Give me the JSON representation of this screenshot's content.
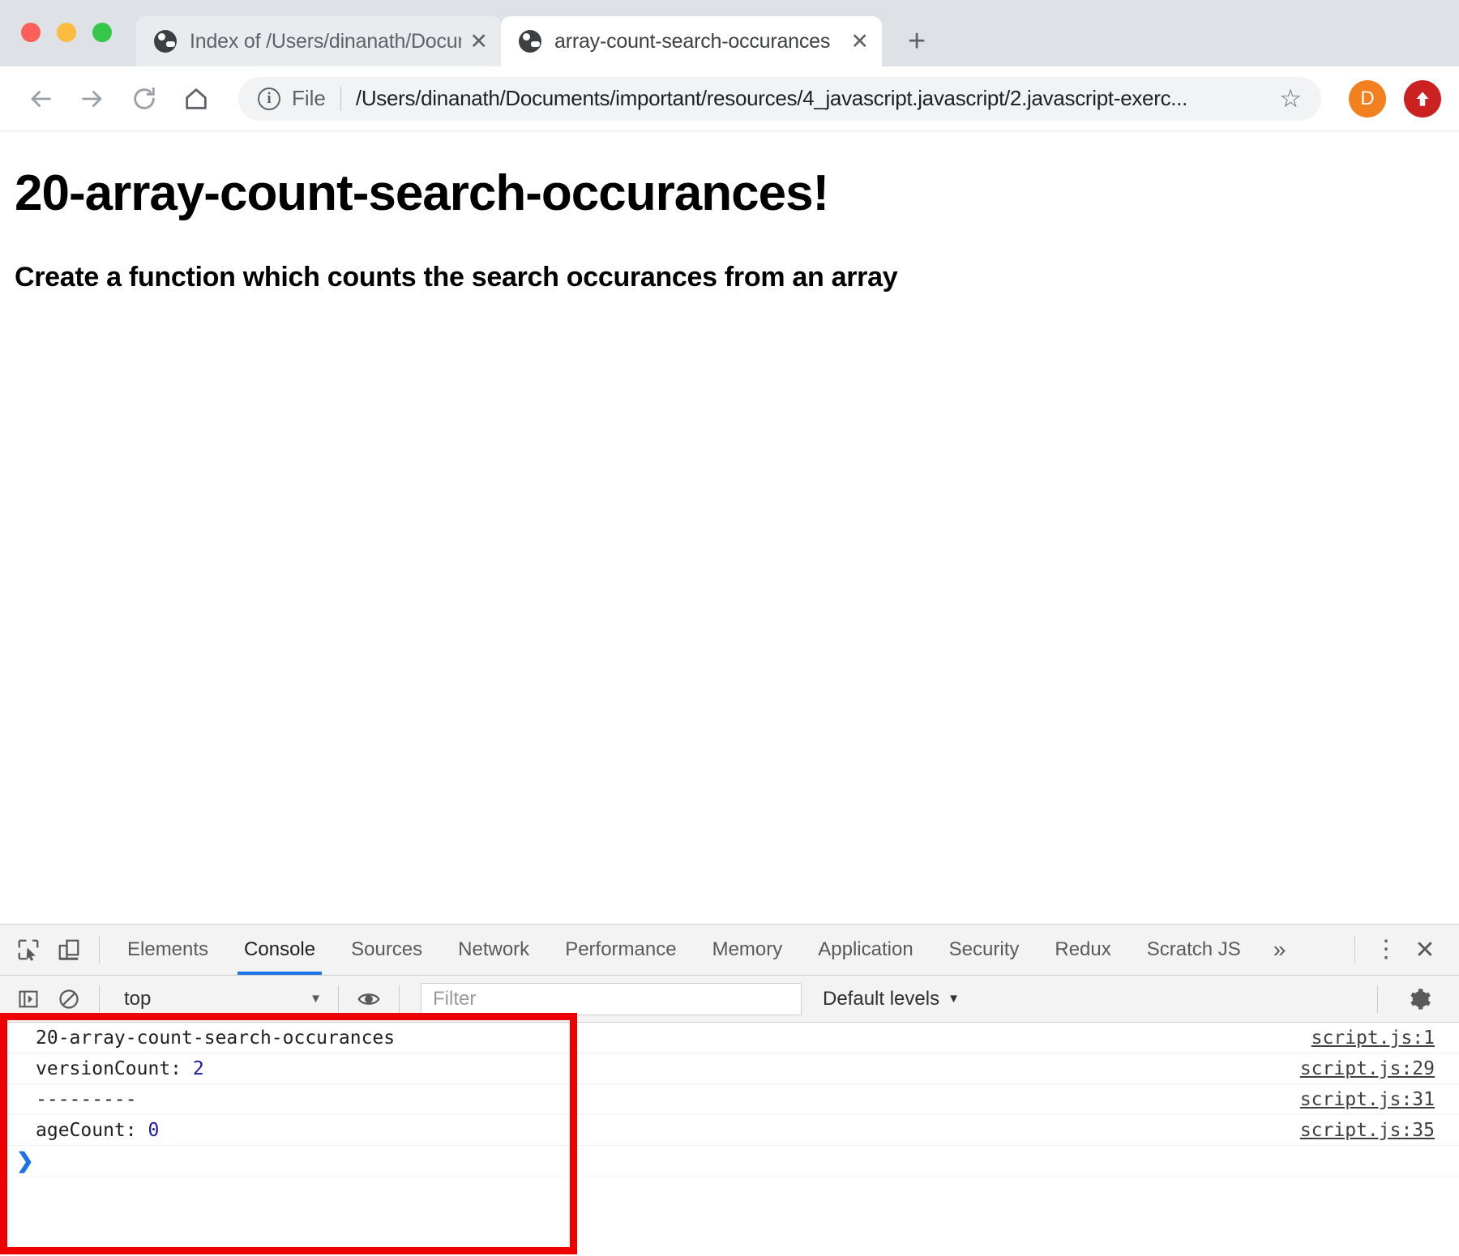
{
  "window": {
    "traffic_lights": [
      "close",
      "minimize",
      "zoom"
    ],
    "colors": {
      "close": "#fc6058",
      "minimize": "#fdbc40",
      "zoom": "#34c749",
      "accent": "#1a73e8",
      "annotation": "#ef0000"
    }
  },
  "tabs": [
    {
      "title": "Index of /Users/dinanath/Docum",
      "favicon": "globe-icon",
      "close": "✕",
      "active": false
    },
    {
      "title": "array-count-search-occurances",
      "favicon": "globe-icon",
      "close": "✕",
      "active": true
    }
  ],
  "newtab_label": "+",
  "toolbar": {
    "back_icon": "arrow-left-icon",
    "forward_icon": "arrow-right-icon",
    "reload_icon": "reload-icon",
    "home_icon": "home-icon",
    "info_glyph": "i",
    "scheme_label": "File",
    "url": "/Users/dinanath/Documents/important/resources/4_javascript.javascript/2.javascript-exerc...",
    "bookmark_icon": "☆",
    "profile_initial": "D",
    "update_icon": "update-arrow-icon"
  },
  "page": {
    "heading": "20-array-count-search-occurances!",
    "subheading": "Create a function which counts the search occurances from an array"
  },
  "devtools": {
    "inspect_icon": "inspect-element-icon",
    "device_icon": "device-toolbar-icon",
    "tabs": [
      {
        "label": "Elements",
        "selected": false
      },
      {
        "label": "Console",
        "selected": true
      },
      {
        "label": "Sources",
        "selected": false
      },
      {
        "label": "Network",
        "selected": false
      },
      {
        "label": "Performance",
        "selected": false
      },
      {
        "label": "Memory",
        "selected": false
      },
      {
        "label": "Application",
        "selected": false
      },
      {
        "label": "Security",
        "selected": false
      },
      {
        "label": "Redux",
        "selected": false
      },
      {
        "label": "Scratch JS",
        "selected": false
      }
    ],
    "more_tabs": "»",
    "kebab": "⋮",
    "close": "✕",
    "console_toolbar": {
      "sidebar_icon": "console-sidebar-icon",
      "clear_icon": "clear-console-icon",
      "context_value": "top",
      "context_caret": "▼",
      "eye_icon": "live-expression-eye-icon",
      "filter_placeholder": "Filter",
      "filter_value": "",
      "levels_label": "Default levels",
      "levels_caret": "▼",
      "settings_icon": "gear-icon"
    },
    "console_rows": [
      {
        "message": "20-array-count-search-occurances",
        "value": "",
        "source": "script.js:1"
      },
      {
        "message": "versionCount: ",
        "value": "2",
        "source": "script.js:29"
      },
      {
        "message": "---------",
        "value": "",
        "source": "script.js:31"
      },
      {
        "message": "ageCount: ",
        "value": "0",
        "source": "script.js:35"
      }
    ],
    "prompt_symbol": "❯"
  }
}
